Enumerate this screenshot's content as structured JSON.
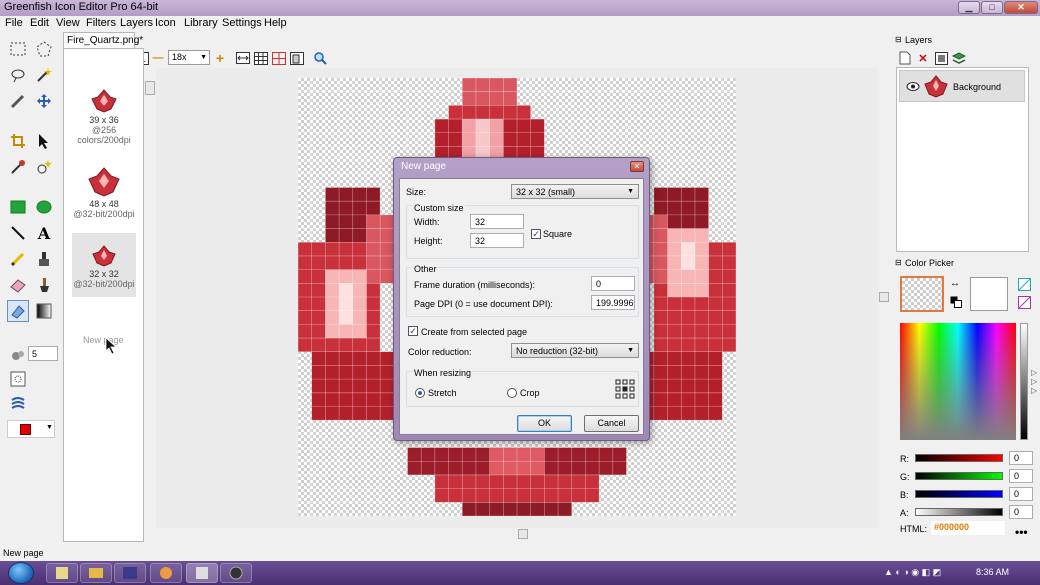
{
  "window": {
    "title": "Greenfish Icon Editor Pro 64-bit"
  },
  "menu": [
    "File",
    "Edit",
    "View",
    "Filters",
    "Layers",
    "Icon",
    "Library",
    "Settings",
    "Help"
  ],
  "document": {
    "tab_label": "Fire_Quartz.png*",
    "zoom": "18x"
  },
  "pages": [
    {
      "size": "39 x 36",
      "info": "@256 colors/200dpi"
    },
    {
      "size": "48 x 48",
      "info": "@32-bit/200dpi"
    },
    {
      "size": "32 x 32",
      "info": "@32-bit/200dpi"
    }
  ],
  "new_page_ghost": "New page",
  "brush_size": "5",
  "dialog": {
    "title": "New page",
    "size_label": "Size:",
    "size_value": "32 x 32 (small)",
    "custom_size_label": "Custom size",
    "width_label": "Width:",
    "width_value": "32",
    "height_label": "Height:",
    "height_value": "32",
    "square_label": "Square",
    "other_label": "Other",
    "frame_duration_label": "Frame duration (milliseconds):",
    "frame_duration_value": "0",
    "dpi_label": "Page DPI (0 = use document DPI):",
    "dpi_value": "199.9996",
    "create_from_selected_label": "Create from selected page",
    "color_reduction_label": "Color reduction:",
    "color_reduction_value": "No reduction (32-bit)",
    "when_resizing_label": "When resizing",
    "stretch_label": "Stretch",
    "crop_label": "Crop",
    "ok_label": "OK",
    "cancel_label": "Cancel"
  },
  "layers": {
    "header": "Layers",
    "items": [
      {
        "name": "Background"
      }
    ]
  },
  "color_picker": {
    "header": "Color Picker",
    "r_label": "R:",
    "r_value": "0",
    "g_label": "G:",
    "g_value": "0",
    "b_label": "B:",
    "b_value": "0",
    "a_label": "A:",
    "a_value": "0",
    "html_label": "HTML:",
    "html_value": "#000000"
  },
  "status": {
    "text": "New page"
  },
  "taskbar": {
    "clock": "8:36 AM"
  }
}
